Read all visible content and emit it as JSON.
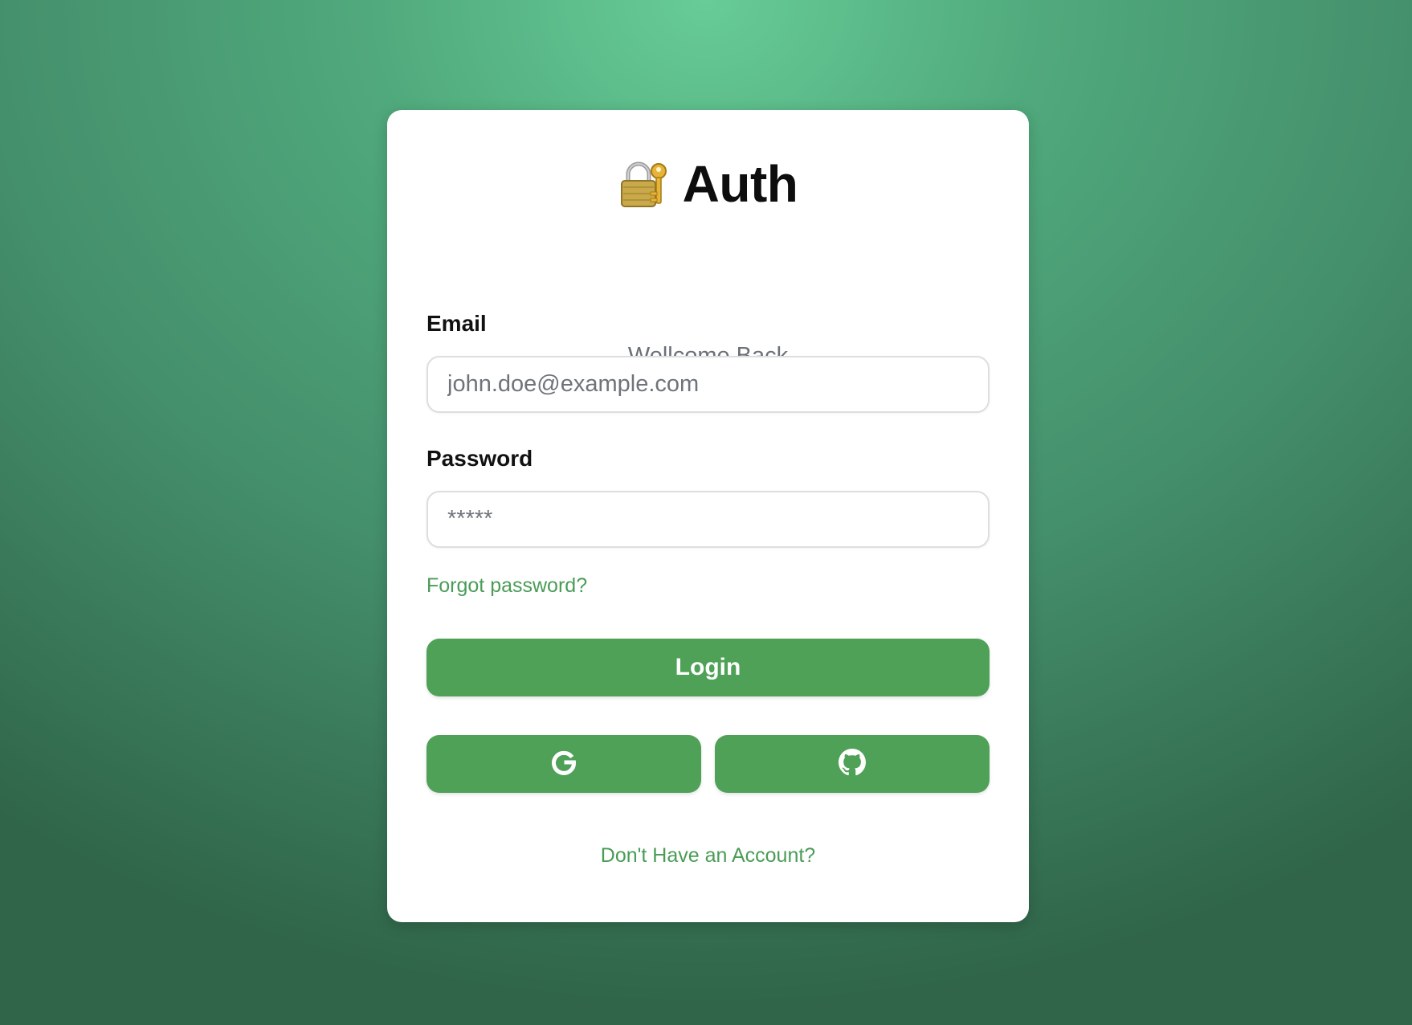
{
  "header": {
    "icon": "lock-with-key-icon",
    "title": "Auth",
    "subtitle": "Wellcome Back"
  },
  "form": {
    "email_label": "Email",
    "email_placeholder": "john.doe@example.com",
    "password_label": "Password",
    "password_placeholder": "*****",
    "forgot_password": "Forgot password?",
    "login_label": "Login"
  },
  "social": {
    "google_icon": "google-icon",
    "github_icon": "github-icon"
  },
  "footer": {
    "signup_link": "Don't Have an Account?"
  },
  "colors": {
    "accent": "#4fa157",
    "link": "#4a9c57",
    "background_light": "#67cc97",
    "background_dark": "#306549"
  }
}
